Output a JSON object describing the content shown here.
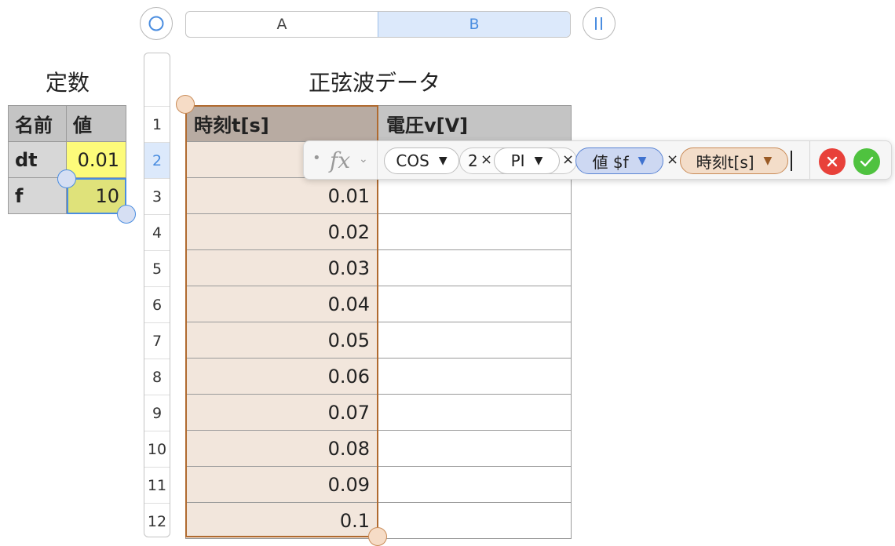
{
  "column_bar": {
    "a": "A",
    "b": "B"
  },
  "constants": {
    "title": "定数",
    "headers": [
      "名前",
      "値"
    ],
    "rows": [
      {
        "name": "dt",
        "value": "0.01"
      },
      {
        "name": "f",
        "value": "10"
      }
    ]
  },
  "sine": {
    "title": "正弦波データ",
    "headers": [
      "時刻t[s]",
      "電圧v[V]"
    ],
    "time_values": [
      "",
      "0.01",
      "0.02",
      "0.03",
      "0.04",
      "0.05",
      "0.06",
      "0.07",
      "0.08",
      "0.09",
      "0.1"
    ]
  },
  "row_numbers": [
    "1",
    "2",
    "3",
    "4",
    "5",
    "6",
    "7",
    "8",
    "9",
    "10",
    "11",
    "12"
  ],
  "formula": {
    "fx": "fx",
    "func": "COS",
    "two": "2",
    "times": "×",
    "pi": "PI",
    "ref_f": "値 $f",
    "ref_t": "時刻t[s]"
  },
  "colors": {
    "accent": "#4a8de0",
    "time_column": "#f2e6dc",
    "highlight_yellow": "#fdfb7a",
    "highlight_green": "#dfe27a",
    "cancel": "#e8413a",
    "confirm": "#4fc23f"
  }
}
